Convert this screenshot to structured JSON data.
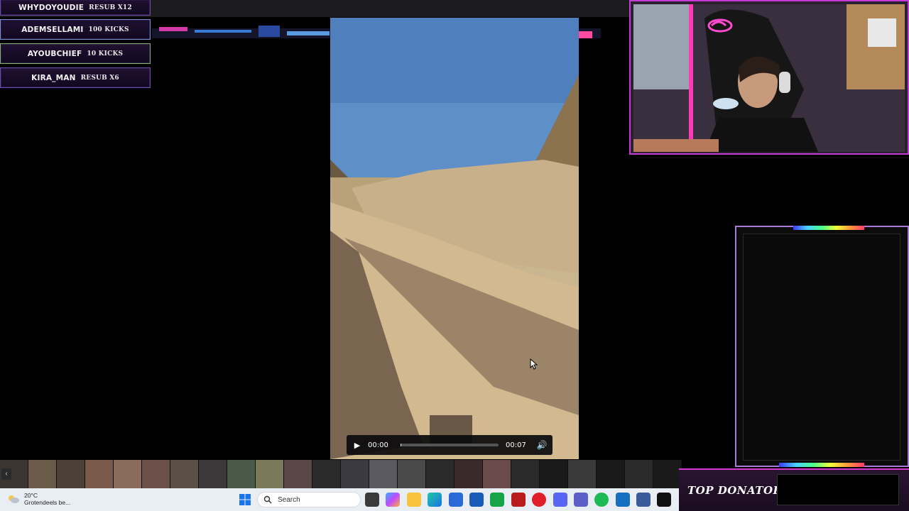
{
  "alerts": [
    {
      "name": "WHYDOYOUDIE",
      "amount": "RESUB X12"
    },
    {
      "name": "ADEMSELLAMI",
      "amount": "100 KICKS"
    },
    {
      "name": "AYOUBCHIEF",
      "amount": "10 KICKS"
    },
    {
      "name": "KIRA_MAN",
      "amount": "RESUB X6"
    }
  ],
  "video": {
    "current_time": "00:00",
    "duration": "00:07",
    "progress": 0.01
  },
  "donator": {
    "label": "TOP DONATOR"
  },
  "taskbar": {
    "weather_temp": "20°C",
    "weather_desc": "Grotendeels be...",
    "search_placeholder": "Search",
    "icons": [
      "task-view-icon",
      "copilot-icon",
      "file-explorer-icon",
      "edge-icon",
      "store-icon",
      "outlook-icon",
      "game-icon",
      "app-red-icon",
      "opera-icon",
      "discord-icon",
      "teams-icon",
      "spotify-icon",
      "remote-icon",
      "vpn-icon",
      "capcut-icon"
    ]
  },
  "colors": {
    "accent_purple": "#c63bd8",
    "alert_border": "#6b4da8",
    "taskbar_bg": "#e9eef4"
  }
}
